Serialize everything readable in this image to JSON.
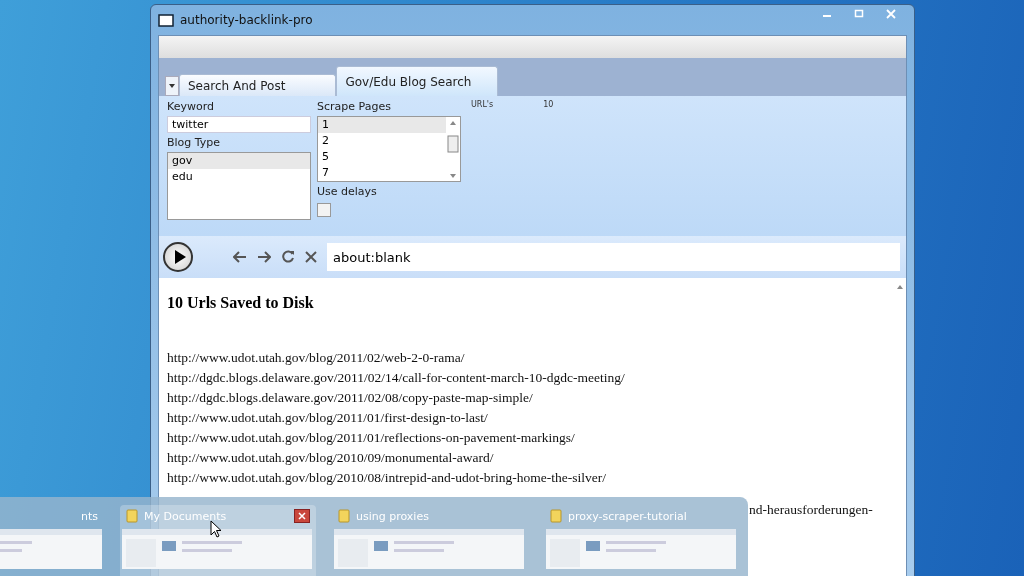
{
  "window": {
    "title": "authority-backlink-pro"
  },
  "tabs": [
    {
      "label": "Search And Post",
      "selected": false
    },
    {
      "label": "Gov/Edu Blog Search",
      "selected": true
    }
  ],
  "form": {
    "keyword_label": "Keyword",
    "keyword_value": "twitter",
    "blog_type_label": "Blog Type",
    "blog_types": [
      {
        "label": "gov",
        "selected": true
      },
      {
        "label": "edu",
        "selected": false
      }
    ],
    "scrape_pages_label": "Scrape Pages",
    "scrape_pages": [
      {
        "label": "1",
        "selected": true
      },
      {
        "label": "2",
        "selected": false
      },
      {
        "label": "5",
        "selected": false
      },
      {
        "label": "7",
        "selected": false
      }
    ],
    "use_delays_label": "Use delays",
    "use_delays": false,
    "urls_label": "URL's",
    "urls_count": "10"
  },
  "browser": {
    "address": "about:blank",
    "heading": "10 Urls Saved to Disk",
    "urls": [
      "http://www.udot.utah.gov/blog/2011/02/web-2-0-rama/",
      "http://dgdc.blogs.delaware.gov/2011/02/14/call-for-content-march-10-dgdc-meeting/",
      "http://dgdc.blogs.delaware.gov/2011/02/08/copy-paste-map-simple/",
      "http://www.udot.utah.gov/blog/2011/01/first-design-to-last/",
      "http://www.udot.utah.gov/blog/2011/01/reflections-on-pavement-markings/",
      "http://www.udot.utah.gov/blog/2010/09/monumental-award/",
      "http://www.udot.utah.gov/blog/2010/08/intrepid-and-udot-bring-home-the-silver/"
    ],
    "partial_line": "nd-herausforderungen-"
  },
  "taskbar_previews": [
    {
      "title": "nts",
      "selected": false
    },
    {
      "title": "My Documents",
      "selected": true
    },
    {
      "title": "using proxies",
      "selected": false
    },
    {
      "title": "proxy-scraper-tutorial",
      "selected": false
    }
  ]
}
